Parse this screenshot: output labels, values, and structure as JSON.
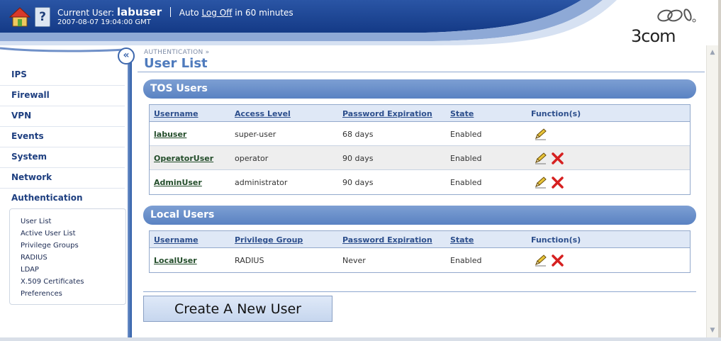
{
  "header": {
    "current_user_label": "Current User:",
    "current_user": "labuser",
    "auto_label": "Auto",
    "log_off_link": "Log Off",
    "log_off_suffix": "in 60 minutes",
    "timestamp": "2007-08-07 19:04:00 GMT",
    "help_glyph": "?",
    "logo_text": "3COM",
    "home_icon": "home-icon",
    "help_icon": "help-icon"
  },
  "sidebar": {
    "collapse_glyph": "«",
    "items": [
      {
        "label": "IPS"
      },
      {
        "label": "Firewall"
      },
      {
        "label": "VPN"
      },
      {
        "label": "Events"
      },
      {
        "label": "System"
      },
      {
        "label": "Network"
      },
      {
        "label": "Authentication"
      }
    ],
    "subitems": [
      {
        "label": "User List"
      },
      {
        "label": "Active User List"
      },
      {
        "label": "Privilege Groups"
      },
      {
        "label": "RADIUS"
      },
      {
        "label": "LDAP"
      },
      {
        "label": "X.509 Certificates"
      },
      {
        "label": "Preferences"
      }
    ]
  },
  "main": {
    "breadcrumb": "AUTHENTICATION »",
    "title": "User List",
    "tos_section": {
      "title": "TOS Users",
      "columns": [
        "Username",
        "Access Level",
        "Password Expiration",
        "State",
        "Function(s)"
      ],
      "rows": [
        {
          "username": "labuser",
          "level": "super-user",
          "expiration": "68 days",
          "state": "Enabled",
          "functions": [
            "edit-icon"
          ]
        },
        {
          "username": "OperatorUser",
          "level": "operator",
          "expiration": "90 days",
          "state": "Enabled",
          "functions": [
            "edit-icon",
            "delete-icon"
          ]
        },
        {
          "username": "AdminUser",
          "level": "administrator",
          "expiration": "90 days",
          "state": "Enabled",
          "functions": [
            "edit-icon",
            "delete-icon"
          ]
        }
      ]
    },
    "local_section": {
      "title": "Local Users",
      "columns": [
        "Username",
        "Privilege Group",
        "Password Expiration",
        "State",
        "Function(s)"
      ],
      "rows": [
        {
          "username": "LocalUser",
          "group": "RADIUS",
          "expiration": "Never",
          "state": "Enabled",
          "functions": [
            "edit-icon",
            "delete-icon"
          ]
        }
      ]
    },
    "create_button": "Create A New User"
  },
  "colors": {
    "header_blue": "#1f4a9a",
    "section_blue": "#6b8fca",
    "nav_text": "#1e3f80",
    "delete_red": "#d62020",
    "edit_yellow": "#e8c43a"
  }
}
